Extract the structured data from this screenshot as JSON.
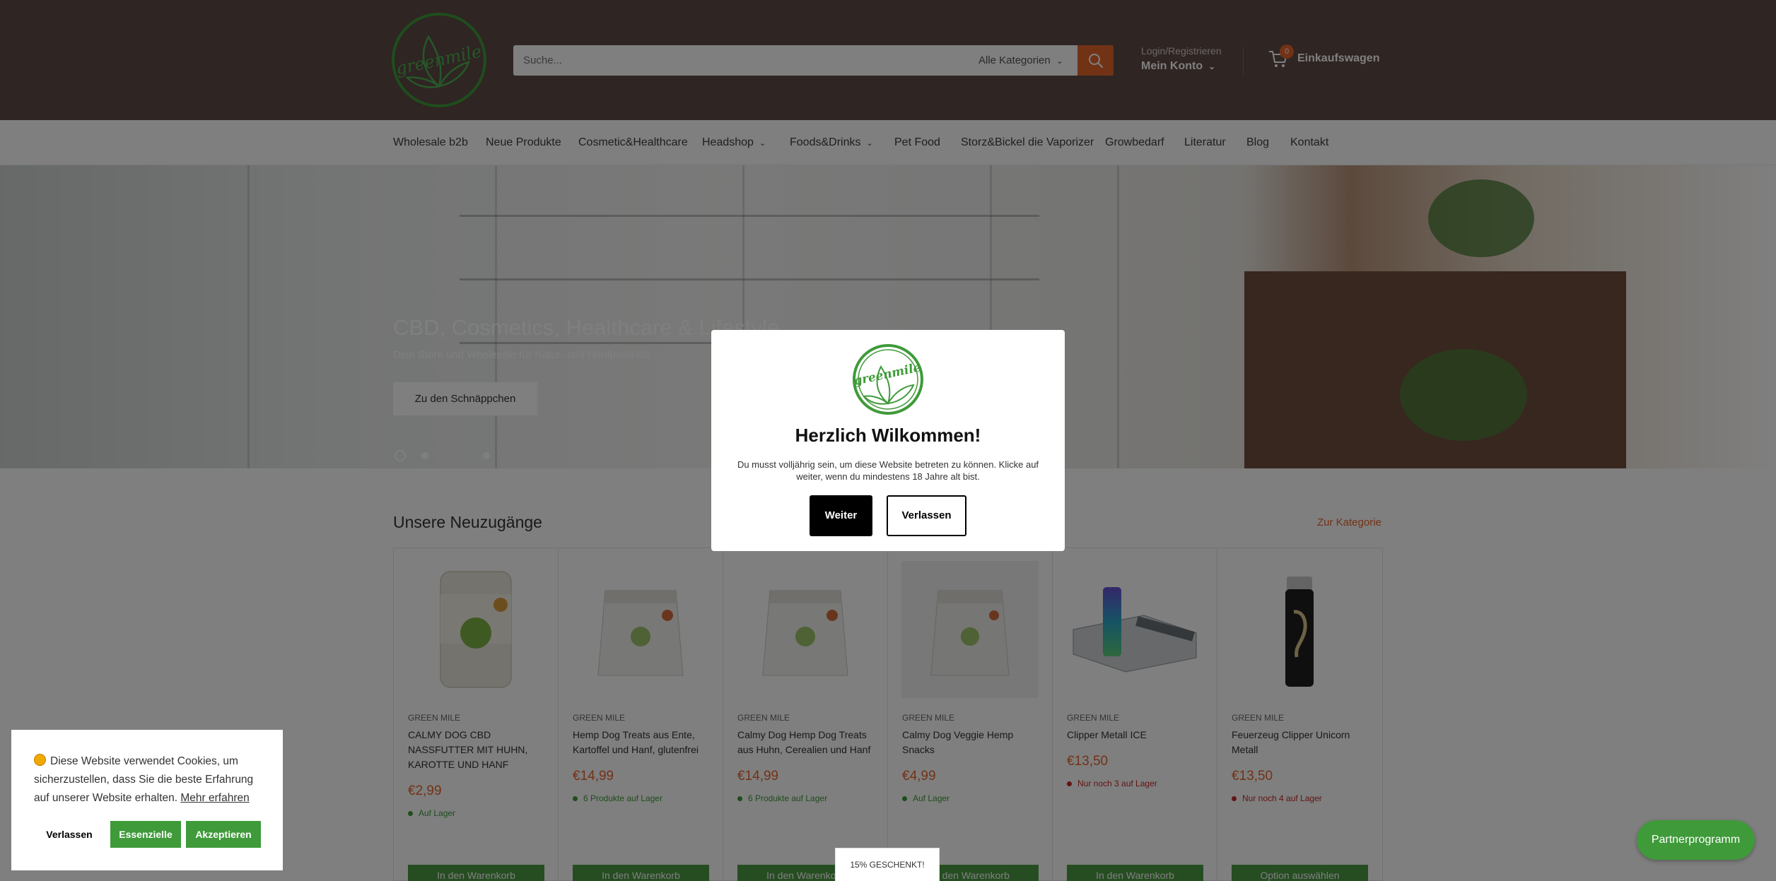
{
  "header": {
    "logo_text": "greenmile",
    "search_placeholder": "Suche...",
    "category_select": "Alle Kategorien",
    "login_label": "Login/Registrieren",
    "account_label": "Mein Konto",
    "cart_count": "0",
    "cart_label": "Einkaufswagen"
  },
  "nav": {
    "items": [
      {
        "label": "Wholesale b2b"
      },
      {
        "label": "Neue Produkte"
      },
      {
        "label": "Cosmetic&Healthcare"
      },
      {
        "label": "Headshop"
      },
      {
        "label": "Foods&Drinks"
      },
      {
        "label": "Pet Food"
      },
      {
        "label": "Storz&Bickel die Vaporizer"
      },
      {
        "label": "Growbedarf"
      },
      {
        "label": "Literatur"
      },
      {
        "label": "Blog"
      },
      {
        "label": "Kontakt"
      }
    ]
  },
  "hero": {
    "title": "CBD, Cosmetics, Healthcare & Lifestyle",
    "subtitle": "Dein Store und Wholesale für Natur- und Hanfprodukte",
    "button": "Zu den Schnäppchen"
  },
  "products": {
    "title": "Unsere Neuzugänge",
    "link": "Zur Kategorie",
    "items": [
      {
        "brand": "GREEN MILE",
        "name": "CALMY DOG CBD NASSFUTTER MIT HUHN, KAROTTE UND HANF",
        "price": "€2,99",
        "stock": "Auf Lager",
        "stock_status": "in",
        "button": "In den Warenkorb"
      },
      {
        "brand": "GREEN MILE",
        "name": "Hemp Dog Treats aus Ente, Kartoffel und Hanf, glutenfrei",
        "price": "€14,99",
        "stock": "6 Produkte auf Lager",
        "stock_status": "in",
        "button": "In den Warenkorb"
      },
      {
        "brand": "GREEN MILE",
        "name": "Calmy Dog Hemp Dog Treats aus Huhn, Cerealien und Hanf",
        "price": "€14,99",
        "stock": "6 Produkte auf Lager",
        "stock_status": "in",
        "button": "In den Warenkorb"
      },
      {
        "brand": "GREEN MILE",
        "name": "Calmy Dog Veggie Hemp Snacks",
        "price": "€4,99",
        "stock": "Auf Lager",
        "stock_status": "in",
        "button": "In den Warenkorb"
      },
      {
        "brand": "GREEN MILE",
        "name": "Clipper Metall ICE",
        "price": "€13,50",
        "stock": "Nur noch 3 auf Lager",
        "stock_status": "low",
        "button": "In den Warenkorb"
      },
      {
        "brand": "GREEN MILE",
        "name": "Feuerzeug Clipper Unicorn Metall",
        "price": "€13,50",
        "stock": "Nur noch 4 auf Lager",
        "stock_status": "low",
        "button": "Option auswählen"
      }
    ]
  },
  "age_modal": {
    "title": "Herzlich Wilkommen!",
    "text": "Du musst volljährig sein, um diese Website betreten zu können. Klicke auf weiter, wenn du mindestens 18 Jahre alt bist.",
    "confirm": "Weiter",
    "leave": "Verlassen"
  },
  "cookie": {
    "text": "Diese Website verwendet Cookies, um sicherzustellen, dass Sie die beste Erfahrung auf unserer Website erhalten.",
    "link": "Mehr erfahren",
    "leave": "Verlassen",
    "essential": "Essenzielle",
    "accept": "Akzeptieren"
  },
  "gift_tab": "15% GESCHENKT!",
  "partner_button": "Partnerprogramm",
  "colors": {
    "header_bg": "#5e4b47",
    "accent": "#e5652d",
    "brand_green": "#3f9a3a"
  }
}
